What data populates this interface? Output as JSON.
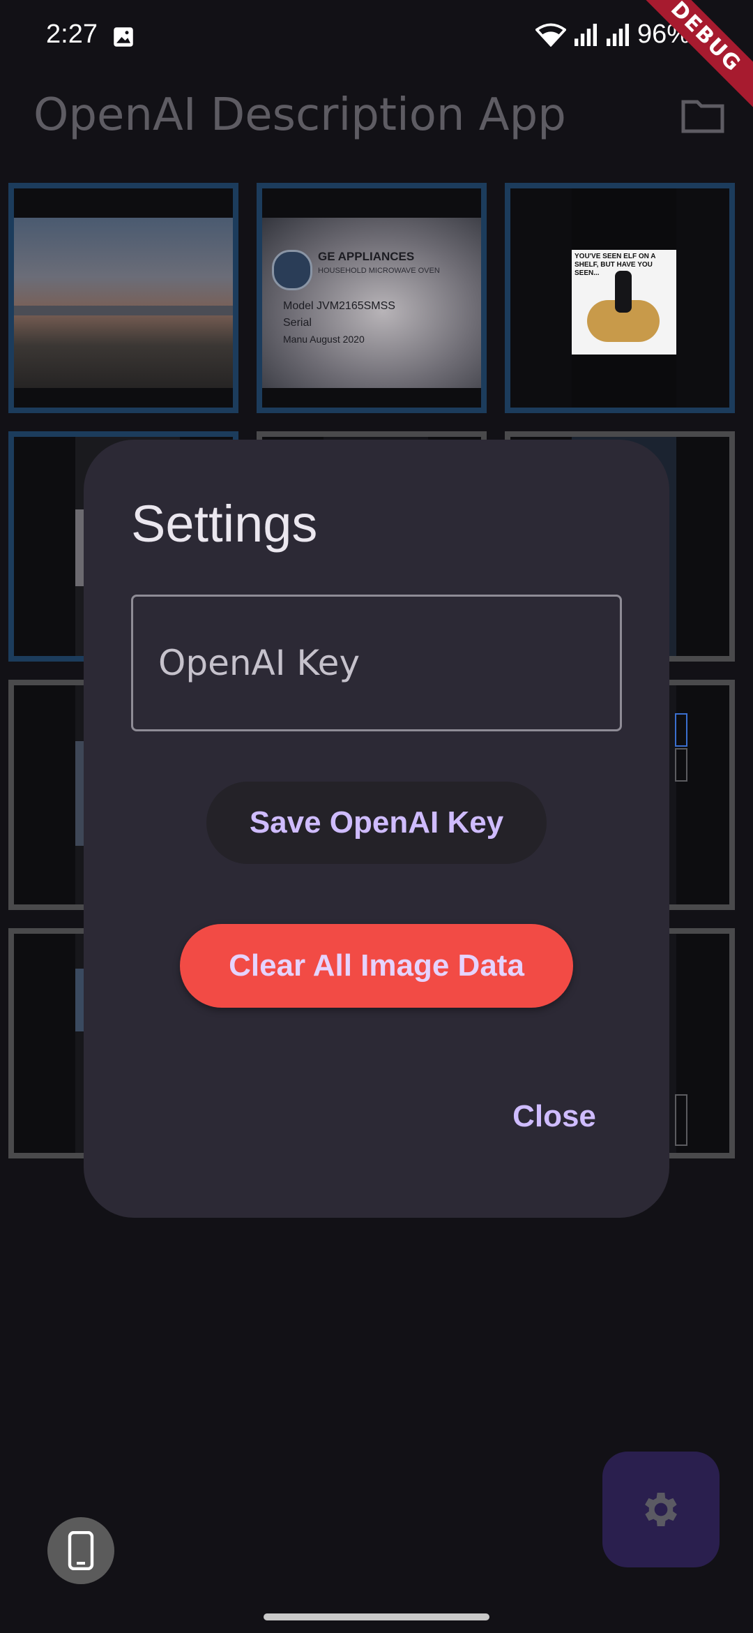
{
  "status_bar": {
    "time": "2:27",
    "battery": "96%",
    "image_icon": "image-icon",
    "wifi_icon": "wifi-icon",
    "signal_icon": "signal-icon",
    "battery_icon": "battery-icon"
  },
  "debug_banner": "DEBUG",
  "app_bar": {
    "title": "OpenAI Description App",
    "folder_icon": "folder-icon"
  },
  "grid": {
    "tiles": [
      {
        "name": "cityscape-image",
        "selected": true
      },
      {
        "name": "appliance-label-image",
        "selected": true,
        "caption_lines": [
          "GE APPLIANCES",
          "HOUSEHOLD MICROWAVE OVEN",
          "Model JVM2165SMSS",
          "Serial",
          "Manu August 2020"
        ]
      },
      {
        "name": "meme-screenshot-image",
        "selected": true,
        "caption": "YOU'VE SEEN ELF ON A SHELF, BUT HAVE YOU SEEN..."
      },
      {
        "name": "screenshot-image",
        "selected": true
      },
      {
        "name": "screenshot-image",
        "selected": false
      },
      {
        "name": "screenshot-image",
        "selected": false
      },
      {
        "name": "screenshot-image",
        "selected": false
      },
      {
        "name": "screenshot-image",
        "selected": false
      },
      {
        "name": "screenshot-image",
        "selected": false
      },
      {
        "name": "screenshot-image",
        "selected": false
      },
      {
        "name": "screenshot-image",
        "selected": false
      },
      {
        "name": "screenshot-image",
        "selected": false
      }
    ]
  },
  "dialog": {
    "title": "Settings",
    "key_field": {
      "placeholder": "OpenAI Key",
      "value": ""
    },
    "save_label": "Save OpenAI Key",
    "clear_label": "Clear All Image Data",
    "close_label": "Close"
  },
  "fab": {
    "icon": "gear-icon"
  },
  "device_button": {
    "icon": "phone-icon"
  },
  "colors": {
    "background": "#121116",
    "dialog": "#2c2935",
    "accent": "#cfbcff",
    "danger": "#f24b45",
    "selected_border": "#1c3c5c"
  }
}
